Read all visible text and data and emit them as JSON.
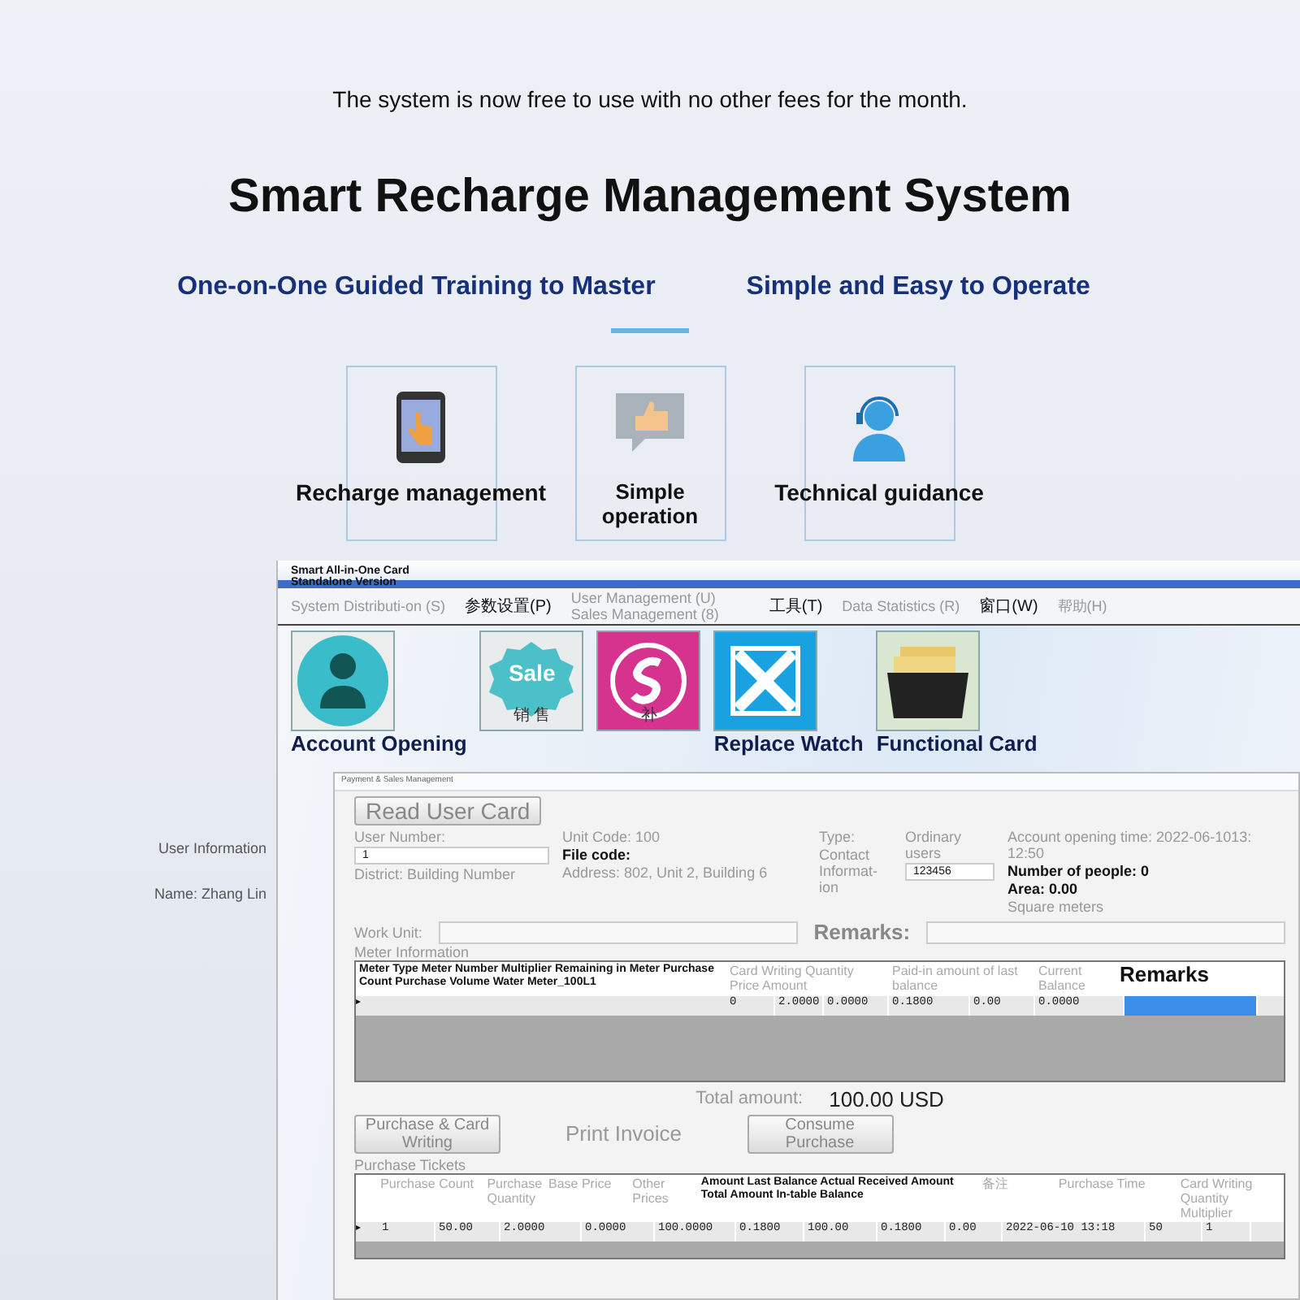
{
  "notice": "The system is now free to use with no other fees for the month.",
  "title": "Smart Recharge Management System",
  "taglines": [
    "One-on-One Guided Training to Master",
    "Simple and Easy to Operate"
  ],
  "features": [
    {
      "kind": "tablet",
      "label": "Recharge management"
    },
    {
      "kind": "thumb",
      "label": "Simple operation"
    },
    {
      "kind": "headset",
      "label": "Technical guidance"
    }
  ],
  "app": {
    "title_lines": [
      "Smart All-in-One Card",
      "Standalone Version"
    ],
    "menu": [
      "System Distributi-on (S)",
      "参数设置(P)",
      "User Management (U) Sales Management (8)",
      "工具(T)",
      "Data Statistics (R)",
      "窗口(W)",
      "帮助(H)"
    ],
    "tools": [
      {
        "kind": "account",
        "label": "Account Opening"
      },
      {
        "kind": "sale",
        "badge": "Sale",
        "label": "销 售"
      },
      {
        "kind": "supplement",
        "label": "补"
      },
      {
        "kind": "replace",
        "label": "Replace Watch"
      },
      {
        "kind": "functional",
        "label": "Functional Card"
      }
    ]
  },
  "side_labels": [
    "User Information",
    "Name: Zhang Lin"
  ],
  "panel": {
    "title": "Payment & Sales Management",
    "read_button": "Read User Card",
    "user_info": [
      [
        {
          "kind": "label",
          "text": "User Number:"
        },
        {
          "kind": "field",
          "text": "1"
        },
        {
          "kind": "label",
          "text": "District: Building Number"
        }
      ],
      [
        {
          "kind": "label",
          "text": "Unit Code: 100"
        },
        {
          "kind": "strong",
          "text": "File code:"
        },
        {
          "kind": "label",
          "text": "Address: 802, Unit 2, Building 6"
        }
      ],
      [
        {
          "kind": "label",
          "text": "Type:"
        },
        {
          "kind": "label",
          "text": "Contact Informat-ion"
        }
      ],
      [
        {
          "kind": "label",
          "text": "Ordinary users"
        },
        {
          "kind": "field",
          "text": "123456"
        }
      ],
      [
        {
          "kind": "label",
          "text": "Account opening time: 2022-06-1013: 12:50"
        },
        {
          "kind": "strong",
          "text": "Number of people: 0"
        },
        {
          "kind": "strong",
          "text": "Area: 0.00"
        },
        {
          "kind": "label",
          "text": "Square meters"
        }
      ]
    ],
    "work_unit": "Work Unit:",
    "remarks": "Remarks:",
    "meter_label": "Meter Information",
    "meter_table": {
      "headers": [
        "Meter Type Meter Number Multiplier Remaining in Meter Purchase Count Purchase Volume Water Meter_100L1",
        "Card Writing Quantity Price Amount",
        "Paid-in amount of last balance",
        "Current Balance",
        "Remarks"
      ],
      "rows": [
        {
          "marker": "▸",
          "cells": [
            {
              "text": "0",
              "selected": false
            },
            {
              "text": "2.0000",
              "selected": false
            },
            {
              "text": "0.0000",
              "selected": false
            },
            {
              "text": "0.1800",
              "selected": false
            },
            {
              "text": "0.00",
              "selected": false
            },
            {
              "text": "0.0000",
              "selected": false
            },
            {
              "selected": true
            }
          ]
        }
      ]
    },
    "total_label": "Total amount:",
    "total_value": "100.00 USD",
    "buttons": [
      "Purchase & Card Writing",
      "Print Invoice",
      "Consume Purchase"
    ],
    "tickets_label": "Purchase Tickets",
    "purchase_table": {
      "headers": [
        "Purchase Count",
        "Purchase Quantity",
        "Base Price",
        "Other Prices",
        "Amount Last Balance Actual Received Amount Total Amount In-table Balance",
        "备注",
        "Purchase Time",
        "Card Writing Quantity Multiplier"
      ],
      "rows": [
        {
          "marker": "▸",
          "cells": [
            "1",
            "50.00",
            "2.0000",
            "0.0000",
            "100.0000",
            "0.1800",
            "100.00",
            "0.1800",
            "0.00",
            "2022-06-10 13:18",
            "50",
            "1"
          ]
        }
      ]
    }
  }
}
